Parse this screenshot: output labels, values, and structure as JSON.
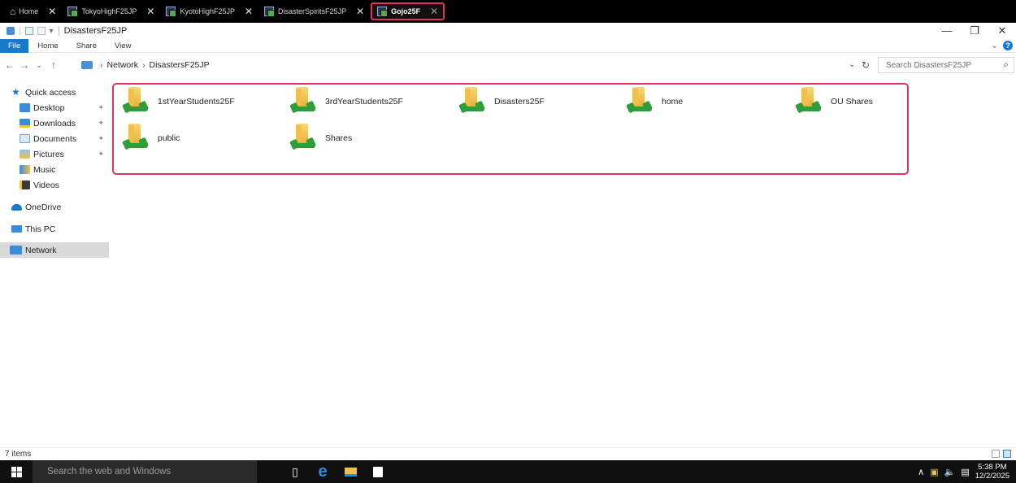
{
  "vm_tabs": [
    {
      "label": "Home",
      "active": false
    },
    {
      "label": "TokyoHighF25JP",
      "active": false
    },
    {
      "label": "KyotoHighF25JP",
      "active": false
    },
    {
      "label": "DisasterSpiritsF25JP",
      "active": false
    },
    {
      "label": "Gojo25F",
      "active": true
    }
  ],
  "window": {
    "title": "DisastersF25JP",
    "minimize_glyph": "—",
    "maximize_glyph": "❐",
    "close_glyph": "✕"
  },
  "ribbon": {
    "tabs": [
      "File",
      "Home",
      "Share",
      "View"
    ],
    "help_glyph": "?"
  },
  "address": {
    "back": "←",
    "forward": "→",
    "recent": "⌄",
    "up": "↑",
    "path": [
      "Network",
      "DisastersF25JP"
    ],
    "search_placeholder": "Search DisastersF25JP"
  },
  "nav_pane": {
    "items": [
      {
        "label": "Quick access",
        "icon": "star-icon",
        "pinned": false
      },
      {
        "label": "Desktop",
        "icon": "desktop-icon",
        "pinned": true
      },
      {
        "label": "Downloads",
        "icon": "downloads-icon",
        "pinned": true
      },
      {
        "label": "Documents",
        "icon": "documents-icon",
        "pinned": true
      },
      {
        "label": "Pictures",
        "icon": "pictures-icon",
        "pinned": true
      },
      {
        "label": "Music",
        "icon": "music-icon",
        "pinned": false
      },
      {
        "label": "Videos",
        "icon": "videos-icon",
        "pinned": false
      },
      {
        "label": "OneDrive",
        "icon": "onedrive-icon",
        "pinned": false
      },
      {
        "label": "This PC",
        "icon": "this-pc-icon",
        "pinned": false
      },
      {
        "label": "Network",
        "icon": "network-icon",
        "pinned": false,
        "selected": true
      }
    ]
  },
  "shares": [
    {
      "name": "1stYearStudents25F"
    },
    {
      "name": "3rdYearStudents25F"
    },
    {
      "name": "Disasters25F"
    },
    {
      "name": "home"
    },
    {
      "name": "OU Shares"
    },
    {
      "name": "public"
    },
    {
      "name": "Shares"
    }
  ],
  "status": {
    "item_count": "7 items"
  },
  "taskbar": {
    "search_placeholder": "Search the web and Windows",
    "time": "5:38 PM",
    "date": "12/2/2025"
  },
  "colors": {
    "highlight": "#e8305f",
    "accent": "#1979ca",
    "selected_nav": "#d9d9d9",
    "taskbar": "#101010"
  }
}
